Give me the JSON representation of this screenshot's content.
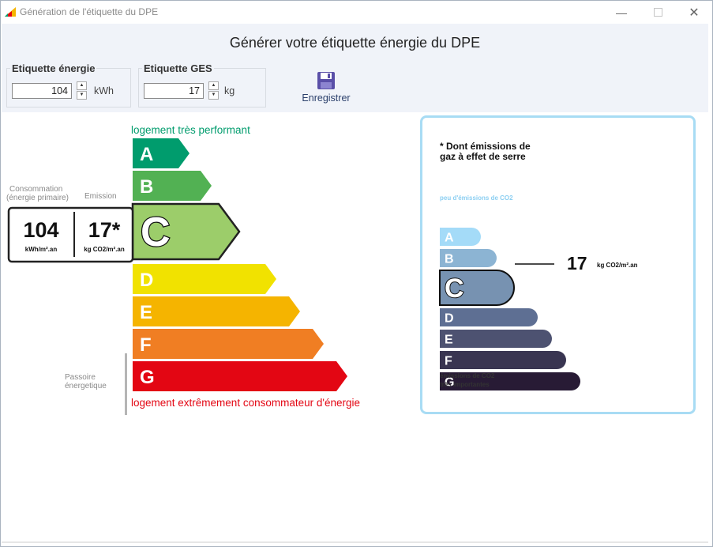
{
  "window": {
    "title": "Génération de l'étiquette du DPE"
  },
  "header": {
    "title": "Générer votre étiquette énergie du DPE"
  },
  "energy_group": {
    "label": "Etiquette énergie",
    "value": "104",
    "unit": "kWh"
  },
  "ges_group": {
    "label": "Etiquette GES",
    "value": "17",
    "unit": "kg"
  },
  "toolbar": {
    "save_label": "Enregistrer"
  },
  "energy_label": {
    "top_text": "logement très performant",
    "bottom_text": "logement extrêmement consommateur d'énergie",
    "consumption_caption": "Consommation (énergie primaire)",
    "emission_caption": "Emission",
    "passoire_caption": "Passoire énergetique",
    "consumption_value": "104",
    "consumption_unit": "kWh/m².an",
    "emission_value": "17*",
    "emission_unit": "kg CO2/m².an",
    "active_class": "C",
    "classes": [
      {
        "letter": "A",
        "color": "#009c6d"
      },
      {
        "letter": "B",
        "color": "#52b153"
      },
      {
        "letter": "C",
        "color": "#9ccd6a"
      },
      {
        "letter": "D",
        "color": "#f1e200"
      },
      {
        "letter": "E",
        "color": "#f5b400"
      },
      {
        "letter": "F",
        "color": "#f07e23"
      },
      {
        "letter": "G",
        "color": "#e30613"
      }
    ]
  },
  "ges_label": {
    "title_line1": "* Dont émissions de",
    "title_line2": "gaz à effet de serre",
    "top_text": "peu d'émissions de CO2",
    "bottom_line1": "émissions de CO2",
    "bottom_line2": "très importantes",
    "value": "17",
    "unit": "kg CO2/m².an",
    "active_class": "C",
    "classes": [
      {
        "letter": "A",
        "color": "#a4dbf8"
      },
      {
        "letter": "B",
        "color": "#8cb4d3"
      },
      {
        "letter": "C",
        "color": "#7792b1"
      },
      {
        "letter": "D",
        "color": "#5e6f93"
      },
      {
        "letter": "E",
        "color": "#4d5271"
      },
      {
        "letter": "F",
        "color": "#393551"
      },
      {
        "letter": "G",
        "color": "#281b35"
      }
    ]
  },
  "colors": {
    "accent_border": "#a8dcf4",
    "top_text": "#009c6d",
    "bottom_text": "#e30613"
  }
}
